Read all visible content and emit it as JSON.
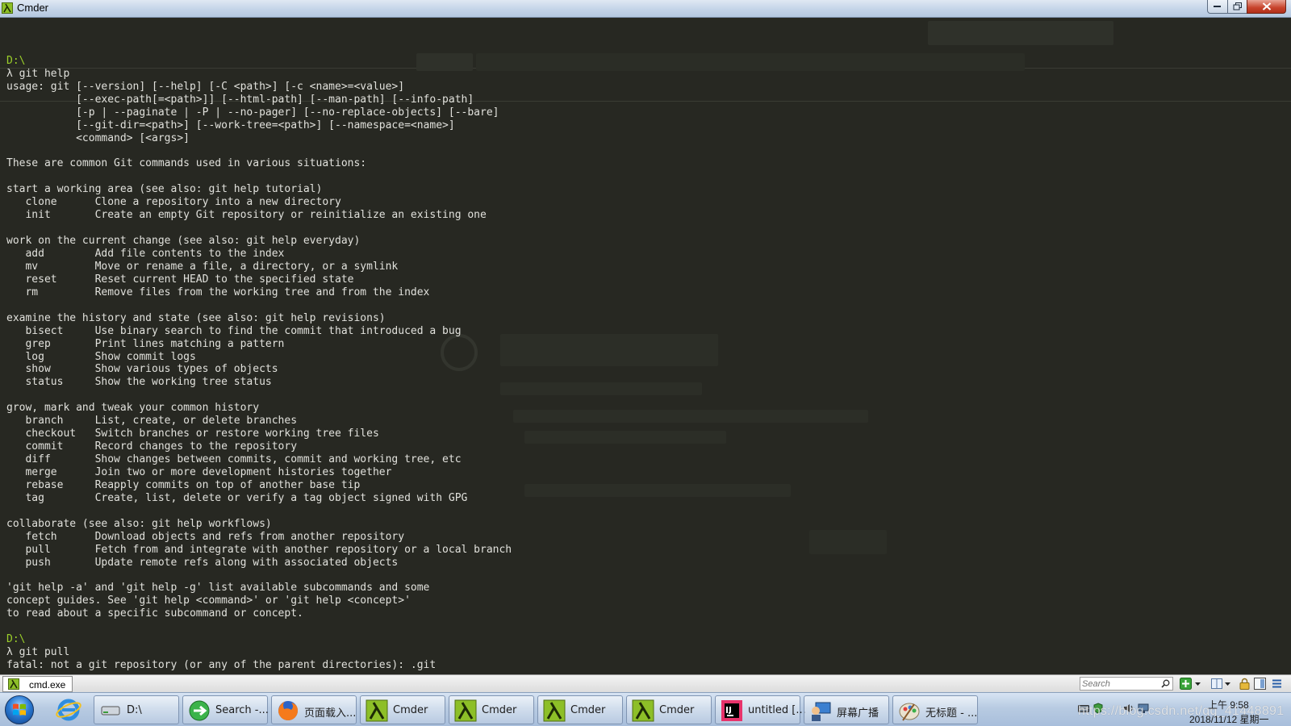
{
  "window": {
    "title": "Cmder"
  },
  "terminal": {
    "lines": [
      {
        "text": ""
      },
      {
        "text": "D:\\",
        "kind": "path"
      },
      {
        "text": "λ git help",
        "kind": "prompt"
      },
      {
        "text": "usage: git [--version] [--help] [-C <path>] [-c <name>=<value>]"
      },
      {
        "text": "           [--exec-path[=<path>]] [--html-path] [--man-path] [--info-path]"
      },
      {
        "text": "           [-p | --paginate | -P | --no-pager] [--no-replace-objects] [--bare]"
      },
      {
        "text": "           [--git-dir=<path>] [--work-tree=<path>] [--namespace=<name>]"
      },
      {
        "text": "           <command> [<args>]"
      },
      {
        "text": ""
      },
      {
        "text": "These are common Git commands used in various situations:"
      },
      {
        "text": ""
      },
      {
        "text": "start a working area (see also: git help tutorial)"
      },
      {
        "text": "   clone      Clone a repository into a new directory"
      },
      {
        "text": "   init       Create an empty Git repository or reinitialize an existing one"
      },
      {
        "text": ""
      },
      {
        "text": "work on the current change (see also: git help everyday)"
      },
      {
        "text": "   add        Add file contents to the index"
      },
      {
        "text": "   mv         Move or rename a file, a directory, or a symlink"
      },
      {
        "text": "   reset      Reset current HEAD to the specified state"
      },
      {
        "text": "   rm         Remove files from the working tree and from the index"
      },
      {
        "text": ""
      },
      {
        "text": "examine the history and state (see also: git help revisions)"
      },
      {
        "text": "   bisect     Use binary search to find the commit that introduced a bug"
      },
      {
        "text": "   grep       Print lines matching a pattern"
      },
      {
        "text": "   log        Show commit logs"
      },
      {
        "text": "   show       Show various types of objects"
      },
      {
        "text": "   status     Show the working tree status"
      },
      {
        "text": ""
      },
      {
        "text": "grow, mark and tweak your common history"
      },
      {
        "text": "   branch     List, create, or delete branches"
      },
      {
        "text": "   checkout   Switch branches or restore working tree files"
      },
      {
        "text": "   commit     Record changes to the repository"
      },
      {
        "text": "   diff       Show changes between commits, commit and working tree, etc"
      },
      {
        "text": "   merge      Join two or more development histories together"
      },
      {
        "text": "   rebase     Reapply commits on top of another base tip"
      },
      {
        "text": "   tag        Create, list, delete or verify a tag object signed with GPG"
      },
      {
        "text": ""
      },
      {
        "text": "collaborate (see also: git help workflows)"
      },
      {
        "text": "   fetch      Download objects and refs from another repository"
      },
      {
        "text": "   pull       Fetch from and integrate with another repository or a local branch"
      },
      {
        "text": "   push       Update remote refs along with associated objects"
      },
      {
        "text": ""
      },
      {
        "text": "'git help -a' and 'git help -g' list available subcommands and some"
      },
      {
        "text": "concept guides. See 'git help <command>' or 'git help <concept>'"
      },
      {
        "text": "to read about a specific subcommand or concept."
      },
      {
        "text": ""
      },
      {
        "text": "D:\\",
        "kind": "path"
      },
      {
        "text": "λ git pull",
        "kind": "prompt"
      },
      {
        "text": "fatal: not a git repository (or any of the parent directories): .git"
      }
    ]
  },
  "tabbar": {
    "active_tab": "cmd.exe",
    "search_placeholder": "Search"
  },
  "taskbar": {
    "buttons": [
      {
        "label": "D:\\",
        "icon": "drive-icon"
      },
      {
        "label": "Search -...",
        "icon": "search-app-icon"
      },
      {
        "label": "页面载入...",
        "icon": "firefox-icon"
      },
      {
        "label": "Cmder",
        "icon": "cmder-icon"
      },
      {
        "label": "Cmder",
        "icon": "cmder-icon"
      },
      {
        "label": "Cmder",
        "icon": "cmder-icon"
      },
      {
        "label": "Cmder",
        "icon": "cmder-icon"
      },
      {
        "label": "untitled [...",
        "icon": "intellij-icon"
      },
      {
        "label": "屏幕广播",
        "icon": "screen-broadcast-icon"
      },
      {
        "label": "无标题 - ...",
        "icon": "paint-icon"
      }
    ],
    "clock": {
      "time": "上午 9:58",
      "date": "2018/11/12 星期一"
    },
    "watermark": "https://blog.csdn.net/qq_41448891"
  }
}
